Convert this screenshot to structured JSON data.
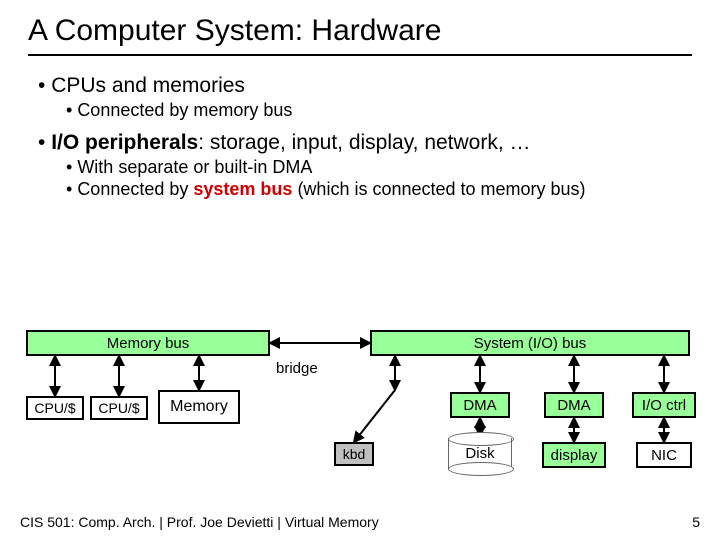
{
  "title": "A Computer System: Hardware",
  "bullets": {
    "b1": "CPUs and memories",
    "b1_1": "Connected by memory bus",
    "b2_pre": "I/O peripherals",
    "b2_post": ": storage, input, display, network, …",
    "b2_1": "With separate or built-in DMA",
    "b2_2_pre": "Connected by ",
    "b2_2_em": "system bus",
    "b2_2_post": " (which is connected to memory bus)"
  },
  "diagram": {
    "bus_mem": "Memory bus",
    "bus_io": "System (I/O) bus",
    "bridge": "bridge",
    "cpu": "CPU/$",
    "memory": "Memory",
    "dma": "DMA",
    "io_ctrl": "I/O ctrl",
    "kbd": "kbd",
    "disk": "Disk",
    "display": "display",
    "nic": "NIC"
  },
  "footer": {
    "left": "CIS 501: Comp. Arch.  |  Prof. Joe Devietti  |  Virtual Memory",
    "right": "5"
  }
}
